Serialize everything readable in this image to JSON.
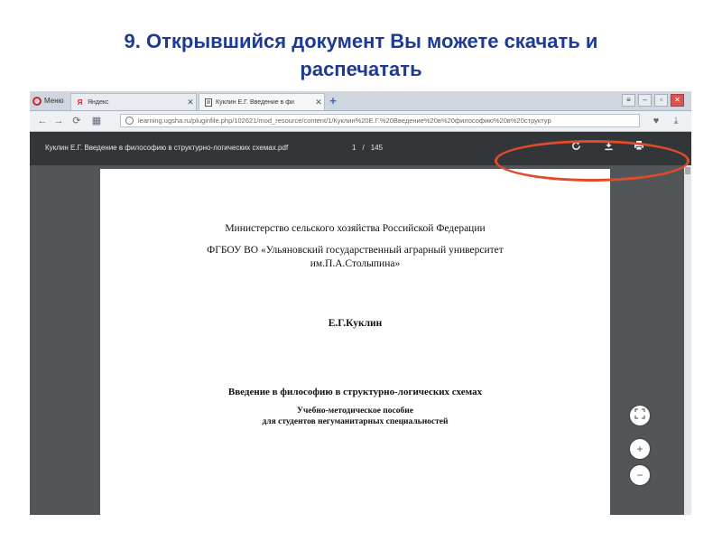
{
  "slide": {
    "title_line1": "9. Открывшийся документ Вы можете скачать и",
    "title_line2": "распечатать"
  },
  "browser": {
    "menu_label": "Меню",
    "tabs": [
      {
        "label": "Яндекс",
        "favicon": "Я",
        "close": "✕"
      },
      {
        "label": "Куклин Е.Г. Введение в фи",
        "favicon": "doc",
        "close": "✕"
      }
    ],
    "new_tab": "+",
    "url": "learning.ugsha.ru/pluginfile.php/102621/mod_resource/content/1/Куклин%20Е.Г.%20Введение%20в%20философию%20в%20структур"
  },
  "pdf": {
    "title": "Куклин Е.Г. Введение в философию в структурно-логических схемах.pdf",
    "page_current": "1",
    "page_sep": "/",
    "page_total": "145",
    "icons": [
      "rotate-icon",
      "download-icon",
      "print-icon"
    ]
  },
  "document": {
    "ministry": "Министерство сельского хозяйства Российской Федерации",
    "university_line1": "ФГБОУ ВО «Ульяновский государственный аграрный университет",
    "university_line2": "им.П.А.Столыпина»",
    "author": "Е.Г.Куклин",
    "book_title": "Введение в философию в структурно-логических схемах",
    "subtitle_line1": "Учебно-методическое пособие",
    "subtitle_line2": "для студентов негуманитарных специальностей"
  },
  "colors": {
    "title": "#1f3a93",
    "highlight": "#e14a2a",
    "pdf_toolbar": "#323639"
  }
}
